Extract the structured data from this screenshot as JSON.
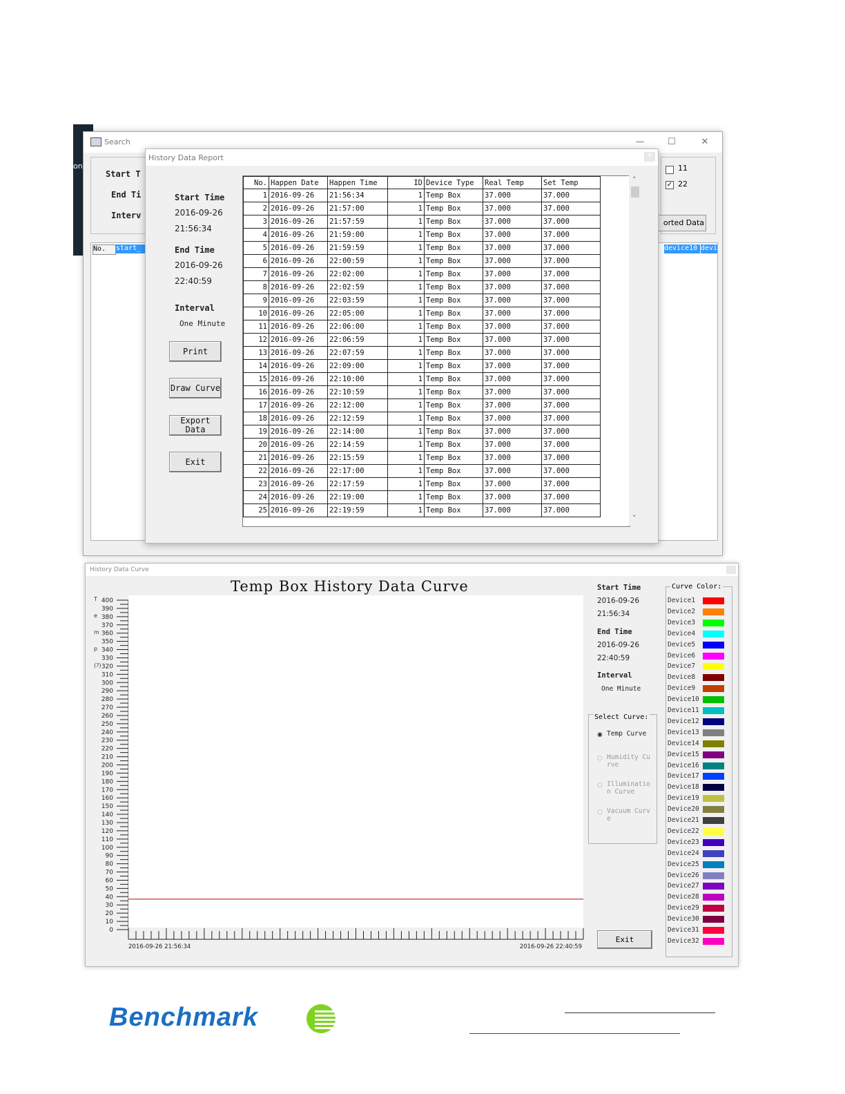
{
  "search_window": {
    "title": "Search",
    "edge_text": "on",
    "labels": {
      "start": "Start T",
      "end": "End Ti",
      "interval": "Interv"
    },
    "checkboxes": [
      {
        "label": "11",
        "checked": false
      },
      {
        "label": "22",
        "checked": true
      }
    ],
    "imported_button": "orted Data",
    "list_headers": {
      "no": "No.",
      "start": "start_",
      "device10": "device10",
      "device11": "devic"
    }
  },
  "report_window": {
    "title": "History Data Report",
    "start_label": "Start Time",
    "start_date": "2016-09-26",
    "start_time": "21:56:34",
    "end_label": "End Time",
    "end_date": "2016-09-26",
    "end_time": "22:40:59",
    "interval_label": "Interval",
    "interval_value": "One Minute",
    "buttons": {
      "print": "Print",
      "draw_curve": "Draw Curve",
      "export_data": "Export Data",
      "exit": "Exit"
    },
    "table": {
      "headers": [
        "No.",
        "Happen Date",
        "Happen Time",
        "ID",
        "Device Type",
        "Real Temp",
        "Set Temp"
      ],
      "rows": [
        [
          "1",
          "2016-09-26",
          "21:56:34",
          "1",
          "Temp Box",
          "37.000",
          "37.000"
        ],
        [
          "2",
          "2016-09-26",
          "21:57:00",
          "1",
          "Temp Box",
          "37.000",
          "37.000"
        ],
        [
          "3",
          "2016-09-26",
          "21:57:59",
          "1",
          "Temp Box",
          "37.000",
          "37.000"
        ],
        [
          "4",
          "2016-09-26",
          "21:59:00",
          "1",
          "Temp Box",
          "37.000",
          "37.000"
        ],
        [
          "5",
          "2016-09-26",
          "21:59:59",
          "1",
          "Temp Box",
          "37.000",
          "37.000"
        ],
        [
          "6",
          "2016-09-26",
          "22:00:59",
          "1",
          "Temp Box",
          "37.000",
          "37.000"
        ],
        [
          "7",
          "2016-09-26",
          "22:02:00",
          "1",
          "Temp Box",
          "37.000",
          "37.000"
        ],
        [
          "8",
          "2016-09-26",
          "22:02:59",
          "1",
          "Temp Box",
          "37.000",
          "37.000"
        ],
        [
          "9",
          "2016-09-26",
          "22:03:59",
          "1",
          "Temp Box",
          "37.000",
          "37.000"
        ],
        [
          "10",
          "2016-09-26",
          "22:05:00",
          "1",
          "Temp Box",
          "37.000",
          "37.000"
        ],
        [
          "11",
          "2016-09-26",
          "22:06:00",
          "1",
          "Temp Box",
          "37.000",
          "37.000"
        ],
        [
          "12",
          "2016-09-26",
          "22:06:59",
          "1",
          "Temp Box",
          "37.000",
          "37.000"
        ],
        [
          "13",
          "2016-09-26",
          "22:07:59",
          "1",
          "Temp Box",
          "37.000",
          "37.000"
        ],
        [
          "14",
          "2016-09-26",
          "22:09:00",
          "1",
          "Temp Box",
          "37.000",
          "37.000"
        ],
        [
          "15",
          "2016-09-26",
          "22:10:00",
          "1",
          "Temp Box",
          "37.000",
          "37.000"
        ],
        [
          "16",
          "2016-09-26",
          "22:10:59",
          "1",
          "Temp Box",
          "37.000",
          "37.000"
        ],
        [
          "17",
          "2016-09-26",
          "22:12:00",
          "1",
          "Temp Box",
          "37.000",
          "37.000"
        ],
        [
          "18",
          "2016-09-26",
          "22:12:59",
          "1",
          "Temp Box",
          "37.000",
          "37.000"
        ],
        [
          "19",
          "2016-09-26",
          "22:14:00",
          "1",
          "Temp Box",
          "37.000",
          "37.000"
        ],
        [
          "20",
          "2016-09-26",
          "22:14:59",
          "1",
          "Temp Box",
          "37.000",
          "37.000"
        ],
        [
          "21",
          "2016-09-26",
          "22:15:59",
          "1",
          "Temp Box",
          "37.000",
          "37.000"
        ],
        [
          "22",
          "2016-09-26",
          "22:17:00",
          "1",
          "Temp Box",
          "37.000",
          "37.000"
        ],
        [
          "23",
          "2016-09-26",
          "22:17:59",
          "1",
          "Temp Box",
          "37.000",
          "37.000"
        ],
        [
          "24",
          "2016-09-26",
          "22:19:00",
          "1",
          "Temp Box",
          "37.000",
          "37.000"
        ],
        [
          "25",
          "2016-09-26",
          "22:19:59",
          "1",
          "Temp Box",
          "37.000",
          "37.000"
        ]
      ]
    }
  },
  "curve_window": {
    "title": "History Data Curve",
    "heading": "Temp Box History Data Curve",
    "y_axis_letters": [
      "T",
      "e",
      "m",
      "p",
      "(?)"
    ],
    "y_ticks": [
      "400",
      "390",
      "380",
      "370",
      "360",
      "350",
      "340",
      "330",
      "320",
      "310",
      "300",
      "290",
      "280",
      "270",
      "260",
      "250",
      "240",
      "230",
      "220",
      "210",
      "200",
      "190",
      "180",
      "170",
      "160",
      "150",
      "140",
      "130",
      "120",
      "110",
      "100",
      "90",
      "80",
      "70",
      "60",
      "50",
      "40",
      "30",
      "20",
      "10",
      "0"
    ],
    "x_start_label": "2016-09-26 21:56:34",
    "x_end_label": "2016-09-26 22:40:59",
    "start_label": "Start Time",
    "start_date": "2016-09-26",
    "start_time": "21:56:34",
    "end_label": "End Time",
    "end_date": "2016-09-26",
    "end_time": "22:40:59",
    "interval_label": "Interval",
    "interval_value": "One Minute",
    "select_curve_label": "Select Curve:",
    "curve_options": [
      {
        "label": "Temp Curve",
        "selected": true,
        "enabled": true
      },
      {
        "label": "Humidity Curve",
        "selected": false,
        "enabled": false
      },
      {
        "label": "Illumination Curve",
        "selected": false,
        "enabled": false
      },
      {
        "label": "Vacuum Curve",
        "selected": false,
        "enabled": false
      }
    ],
    "curve_color_label": "Curve Color:",
    "exit_label": "Exit",
    "devices": [
      {
        "name": "Device1",
        "color": "#ff0000"
      },
      {
        "name": "Device2",
        "color": "#ff8000"
      },
      {
        "name": "Device3",
        "color": "#00ff00"
      },
      {
        "name": "Device4",
        "color": "#00ffff"
      },
      {
        "name": "Device5",
        "color": "#0000ff"
      },
      {
        "name": "Device6",
        "color": "#ff00ff"
      },
      {
        "name": "Device7",
        "color": "#ffff00"
      },
      {
        "name": "Device8",
        "color": "#800000"
      },
      {
        "name": "Device9",
        "color": "#c04000"
      },
      {
        "name": "Device10",
        "color": "#00c000"
      },
      {
        "name": "Device11",
        "color": "#00c0c0"
      },
      {
        "name": "Device12",
        "color": "#000080"
      },
      {
        "name": "Device13",
        "color": "#808080"
      },
      {
        "name": "Device14",
        "color": "#808000"
      },
      {
        "name": "Device15",
        "color": "#800080"
      },
      {
        "name": "Device16",
        "color": "#008080"
      },
      {
        "name": "Device17",
        "color": "#0040ff"
      },
      {
        "name": "Device18",
        "color": "#000040"
      },
      {
        "name": "Device19",
        "color": "#c0c040"
      },
      {
        "name": "Device20",
        "color": "#808040"
      },
      {
        "name": "Device21",
        "color": "#404040"
      },
      {
        "name": "Device22",
        "color": "#ffff40"
      },
      {
        "name": "Device23",
        "color": "#4000c0"
      },
      {
        "name": "Device24",
        "color": "#4040c0"
      },
      {
        "name": "Device25",
        "color": "#0080c0"
      },
      {
        "name": "Device26",
        "color": "#8080c0"
      },
      {
        "name": "Device27",
        "color": "#8000c0"
      },
      {
        "name": "Device28",
        "color": "#c000c0"
      },
      {
        "name": "Device29",
        "color": "#c00040"
      },
      {
        "name": "Device30",
        "color": "#800040"
      },
      {
        "name": "Device31",
        "color": "#ff0040"
      },
      {
        "name": "Device32",
        "color": "#ff00c0"
      }
    ],
    "temp_line_value": 37,
    "temp_line_color": "#c00000"
  },
  "footer": {
    "logo_text": "Benchmark",
    "logo_accent_color": "#7ed321"
  }
}
